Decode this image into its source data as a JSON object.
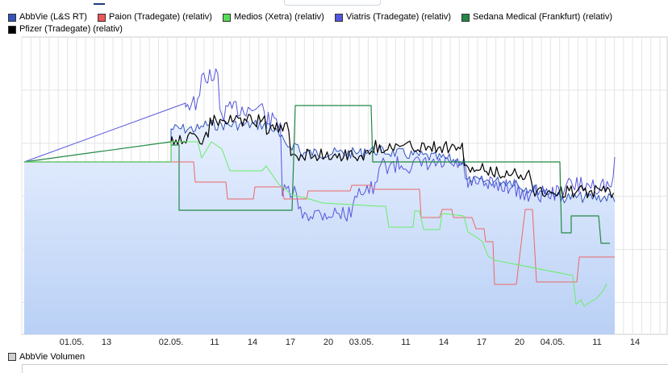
{
  "chart_data": {
    "type": "line",
    "title": "",
    "xlabel": "",
    "ylabel": "",
    "x_tick_labels": [
      "01.05.",
      "13",
      "02.05.",
      "11",
      "14",
      "17",
      "20",
      "03.05.",
      "11",
      "14",
      "17",
      "20",
      "04.05.",
      "11",
      "14"
    ],
    "series": [
      {
        "name": "AbbVie (L&S RT)",
        "color": "#3355bb"
      },
      {
        "name": "Paion (Tradegate) (relativ)",
        "color": "#ee5555"
      },
      {
        "name": "Medios (Xetra) (relativ)",
        "color": "#55dd55"
      },
      {
        "name": "Viatris (Tradegate) (relativ)",
        "color": "#5555dd"
      },
      {
        "name": "Sedana Medical (Frankfurt) (relativ)",
        "color": "#228844"
      },
      {
        "name": "Pfizer (Tradegate) (relativ)",
        "color": "#000000"
      }
    ],
    "grid": true,
    "legend_position": "top"
  },
  "volume_legend": {
    "label": "AbbVie Volumen",
    "color": "#d0d0d0"
  }
}
